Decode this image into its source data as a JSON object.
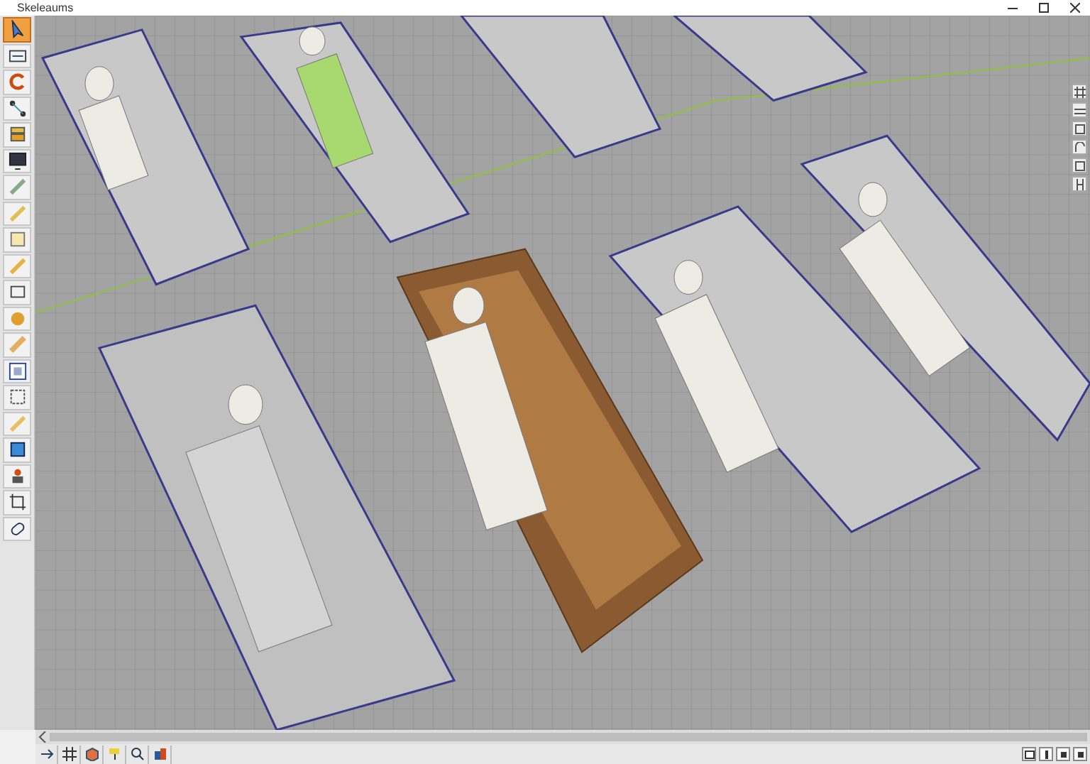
{
  "window": {
    "title": "Skeleaums"
  }
}
